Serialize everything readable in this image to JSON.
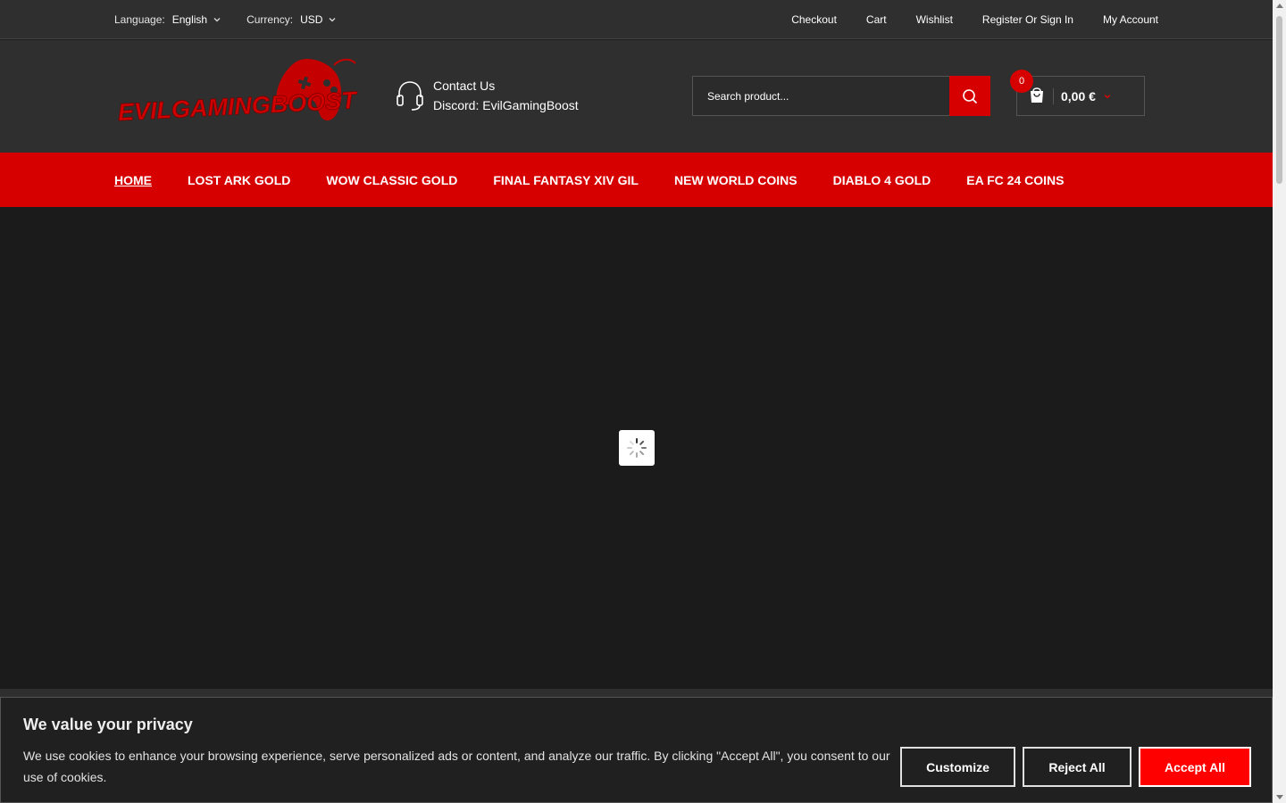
{
  "topbar": {
    "language_label": "Language:",
    "language_value": "English",
    "currency_label": "Currency:",
    "currency_value": "USD",
    "links": [
      "Checkout",
      "Cart",
      "Wishlist",
      "Register Or Sign In",
      "My Account"
    ]
  },
  "header": {
    "logo_text": "EVILGAMINGBOOST",
    "contact_title": "Contact Us",
    "contact_detail": "Discord: EvilGamingBoost",
    "search_placeholder": "Search product...",
    "cart_count": "0",
    "cart_total": "0,00 €"
  },
  "nav": {
    "items": [
      "HOME",
      "LOST ARK GOLD",
      "WOW CLASSIC GOLD",
      "FINAL FANTASY XIV GIL",
      "NEW WORLD COINS",
      "DIABLO 4 GOLD",
      "EA FC 24 COINS"
    ]
  },
  "cookie": {
    "title": "We value your privacy",
    "text": "We use cookies to enhance your browsing experience, serve personalized ads or content, and analyze our traffic. By clicking \"Accept All\", you consent to our use of cookies.",
    "customize": "Customize",
    "reject": "Reject All",
    "accept": "Accept All"
  },
  "colors": {
    "accent": "#d60000",
    "accept_button": "#ff0000",
    "header_bg": "#2f2f2f",
    "page_bg": "#1b1b1c"
  },
  "icons": [
    "chevron-down-icon",
    "headset-icon",
    "search-icon",
    "shopping-bag-icon",
    "loading-spinner-icon",
    "gamepad-logo-icon"
  ]
}
